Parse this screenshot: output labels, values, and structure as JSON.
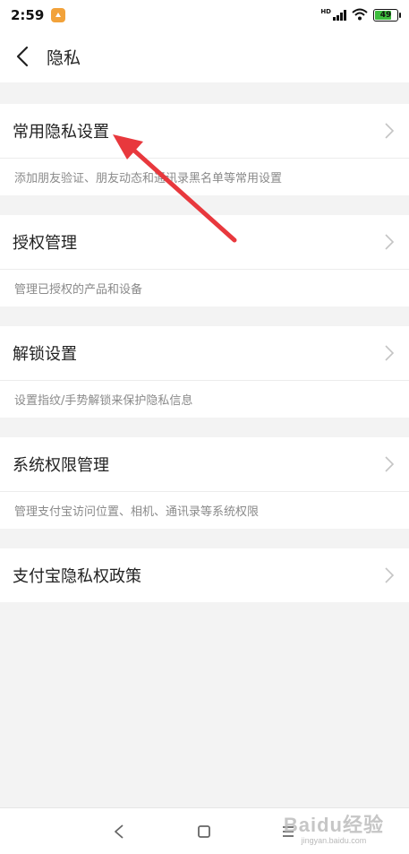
{
  "status_bar": {
    "time": "2:59",
    "hd_label": "HD",
    "battery_level": "49",
    "icons": [
      "app-badge-icon",
      "signal-icon",
      "wifi-icon",
      "battery-icon"
    ]
  },
  "header": {
    "title": "隐私",
    "back_icon": "chevron-left-icon"
  },
  "items": [
    {
      "title": "常用隐私设置",
      "description": "添加朋友验证、朋友动态和通讯录黑名单等常用设置"
    },
    {
      "title": "授权管理",
      "description": "管理已授权的产品和设备"
    },
    {
      "title": "解锁设置",
      "description": "设置指纹/手势解锁来保护隐私信息"
    },
    {
      "title": "系统权限管理",
      "description": "管理支付宝访问位置、相机、通讯录等系统权限"
    },
    {
      "title": "支付宝隐私权政策",
      "description": ""
    }
  ],
  "nav_bar": {
    "icons": [
      "back-triangle-icon",
      "home-square-icon",
      "menu-icon"
    ]
  },
  "watermark": {
    "main": "Baidu经验",
    "sub": "jingyan.baidu.com"
  },
  "colors": {
    "background": "#f3f3f3",
    "card": "#ffffff",
    "annotation_arrow": "#e8383d",
    "battery": "#3dbd3d"
  }
}
